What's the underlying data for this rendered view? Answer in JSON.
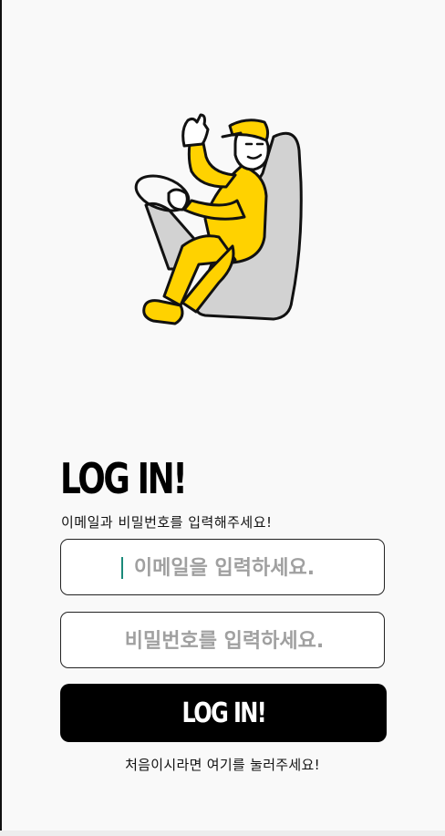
{
  "login": {
    "title": "LOG IN!",
    "subtitle": "이메일과 비밀번호를 입력해주세요!",
    "email_placeholder": "이메일을 입력하세요.",
    "password_placeholder": "비밀번호를 입력하세요.",
    "submit_label": "LOG IN!",
    "signup_prompt": "처음이시라면 여기를 눌러주세요!"
  },
  "illustration": {
    "icon": "driver-waving-illustration",
    "accent_color": "#FFD200",
    "seat_color": "#D2D2D2"
  },
  "colors": {
    "background": "#F9F9F9",
    "button": "#000000",
    "caret": "#1A8A7A"
  }
}
